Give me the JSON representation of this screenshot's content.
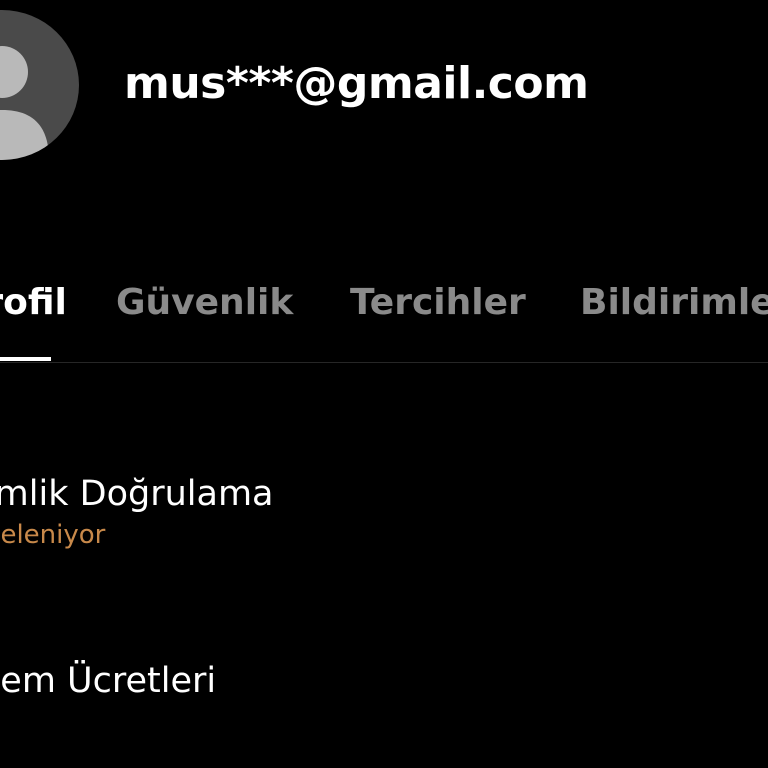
{
  "header": {
    "email": "mus***@gmail.com",
    "avatar_icon": "user-avatar-icon"
  },
  "tabs": [
    {
      "label": "Profil",
      "active": true
    },
    {
      "label": "Güvenlik",
      "active": false
    },
    {
      "label": "Tercihler",
      "active": false
    },
    {
      "label": "Bildirimler",
      "active": false
    }
  ],
  "rows": [
    {
      "title": "Kimlik Doğrulama",
      "status": "İnceleniyor",
      "status_color": "#c8894a"
    },
    {
      "title": "İşlem Ücretleri"
    }
  ],
  "colors": {
    "background": "#000000",
    "tab_inactive": "#8a8a8a",
    "tab_active": "#ffffff",
    "avatar_bg": "#4a4a4a",
    "avatar_fg": "#b9b9b9"
  }
}
